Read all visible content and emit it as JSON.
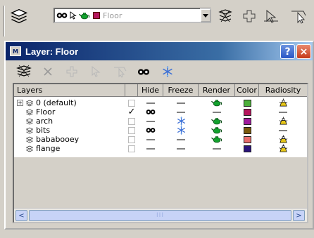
{
  "toolbar": {
    "current_layer": "Floor",
    "layer_swatch_color": "#b5175e",
    "icons": [
      "layers-icon",
      "hide-eye-icon",
      "select-arrow-icon",
      "render-teapot-icon",
      "layer-stack-icon",
      "create-layer-icon",
      "move-to-layer-icon",
      "select-by-layer-icon"
    ]
  },
  "window": {
    "title": "Layer: Floor",
    "help_label": "?",
    "close_label": "×",
    "tools": [
      "create-layer-icon",
      "delete-icon",
      "add-icon",
      "select-icon",
      "set-current-icon",
      "hide-eye-icon",
      "freeze-snowflake-icon"
    ]
  },
  "table": {
    "columns": {
      "layers": "Layers",
      "hide": "Hide",
      "freeze": "Freeze",
      "render": "Render",
      "color": "Color",
      "radiosity": "Radiosity"
    },
    "rows": [
      {
        "name": "0 (default)",
        "expander": "+",
        "current": false,
        "hide": "dash",
        "freeze": "dash",
        "render": "teapot",
        "color": "#4caf3a",
        "radiosity": "radiosity"
      },
      {
        "name": "Floor",
        "expander": "",
        "current": true,
        "hide": "eye",
        "freeze": "dash",
        "render": "dash",
        "color": "#b5175e",
        "radiosity": "dash"
      },
      {
        "name": "arch",
        "expander": "",
        "current": false,
        "hide": "dash",
        "freeze": "snow",
        "render": "teapot",
        "color": "#a01c9e",
        "radiosity": "radiosity"
      },
      {
        "name": "bits",
        "expander": "",
        "current": false,
        "hide": "eye",
        "freeze": "snow",
        "render": "teapot",
        "color": "#7a5a0c",
        "radiosity": "dash"
      },
      {
        "name": "bababooey",
        "expander": "",
        "current": false,
        "hide": "dash",
        "freeze": "dash",
        "render": "teapot",
        "color": "#e86c6c",
        "radiosity": "radiosity"
      },
      {
        "name": "flange",
        "expander": "",
        "current": false,
        "hide": "dash",
        "freeze": "dash",
        "render": "dash",
        "color": "#2a137a",
        "radiosity": "radiosity"
      }
    ],
    "current_mark": "✓"
  },
  "scrollbar": {
    "left_arrow": "<",
    "right_arrow": ">",
    "thumb_grip": "III"
  }
}
